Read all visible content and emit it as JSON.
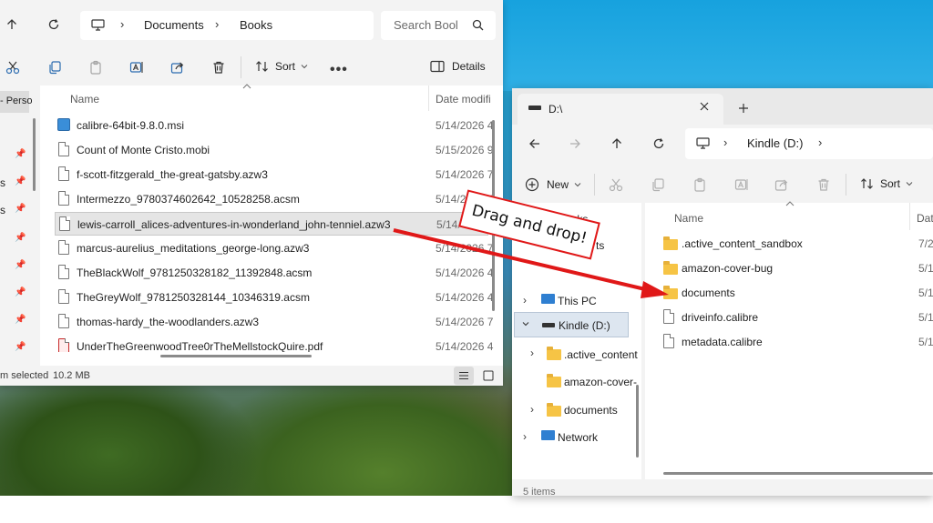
{
  "colors": {
    "accent": "#0067c0",
    "selection": "#e5e5e5",
    "folder": "#f6c445",
    "annotation": "#e01818"
  },
  "left_window": {
    "address": {
      "segments": [
        "Documents",
        "Books"
      ]
    },
    "search": {
      "placeholder": "Search Bool"
    },
    "toolbar": {
      "sort_label": "Sort",
      "details_label": "Details"
    },
    "nav": {
      "partial_item": "- Perso",
      "fragments": [
        "s",
        "s"
      ]
    },
    "columns": {
      "name": "Name",
      "date": "Date modifi"
    },
    "files": [
      {
        "name": "calibre-64bit-9.8.0.msi",
        "date": "5/14/2026 4",
        "icon": "installer-icon"
      },
      {
        "name": "Count of Monte Cristo.mobi",
        "date": "5/15/2026 9",
        "icon": "document-icon"
      },
      {
        "name": "f-scott-fitzgerald_the-great-gatsby.azw3",
        "date": "5/14/2026 7",
        "icon": "document-icon"
      },
      {
        "name": "Intermezzo_9780374602642_10528258.acsm",
        "date": "5/14/2026 4",
        "icon": "document-icon"
      },
      {
        "name": "lewis-carroll_alices-adventures-in-wonderland_john-tenniel.azw3",
        "date": "5/14/",
        "icon": "document-icon",
        "selected": true
      },
      {
        "name": "marcus-aurelius_meditations_george-long.azw3",
        "date": "5/14/2026 7",
        "icon": "document-icon"
      },
      {
        "name": "TheBlackWolf_9781250328182_11392848.acsm",
        "date": "5/14/2026 4",
        "icon": "document-icon"
      },
      {
        "name": "TheGreyWolf_9781250328144_10346319.acsm",
        "date": "5/14/2026 4",
        "icon": "document-icon"
      },
      {
        "name": "thomas-hardy_the-woodlanders.azw3",
        "date": "5/14/2026 7",
        "icon": "document-icon"
      },
      {
        "name": "UnderTheGreenwoodTree0rTheMellstockQuire.pdf",
        "date": "5/14/2026 4",
        "icon": "pdf-icon"
      }
    ],
    "status": {
      "selection": "m selected",
      "size": "10.2 MB"
    }
  },
  "right_window": {
    "tab": {
      "title": "D:\\"
    },
    "address": {
      "segments": [
        "Kindle (D:)"
      ]
    },
    "toolbar": {
      "new_label": "New",
      "sort_label": "Sort"
    },
    "nav": {
      "items": [
        {
          "label": "Books",
          "icon": "folder-icon"
        },
        {
          "label": "This PC",
          "icon": "pc-icon"
        },
        {
          "label": "Kindle (D:)",
          "icon": "drive-icon",
          "selected": true
        },
        {
          "label": ".active_content",
          "icon": "folder-icon"
        },
        {
          "label": "amazon-cover-",
          "icon": "folder-icon"
        },
        {
          "label": "documents",
          "icon": "folder-icon"
        },
        {
          "label": "Network",
          "icon": "network-icon"
        }
      ],
      "fragment": "ts"
    },
    "columns": {
      "name": "Name",
      "date": "Dat"
    },
    "files": [
      {
        "name": ".active_content_sandbox",
        "date": "7/2",
        "icon": "folder-icon"
      },
      {
        "name": "amazon-cover-bug",
        "date": "5/1",
        "icon": "folder-icon"
      },
      {
        "name": "documents",
        "date": "5/1",
        "icon": "folder-icon"
      },
      {
        "name": "driveinfo.calibre",
        "date": "5/1",
        "icon": "document-icon"
      },
      {
        "name": "metadata.calibre",
        "date": "5/1",
        "icon": "document-icon"
      }
    ],
    "status": {
      "count": "5 items"
    }
  },
  "annotation": {
    "text": "Drag and drop!"
  }
}
